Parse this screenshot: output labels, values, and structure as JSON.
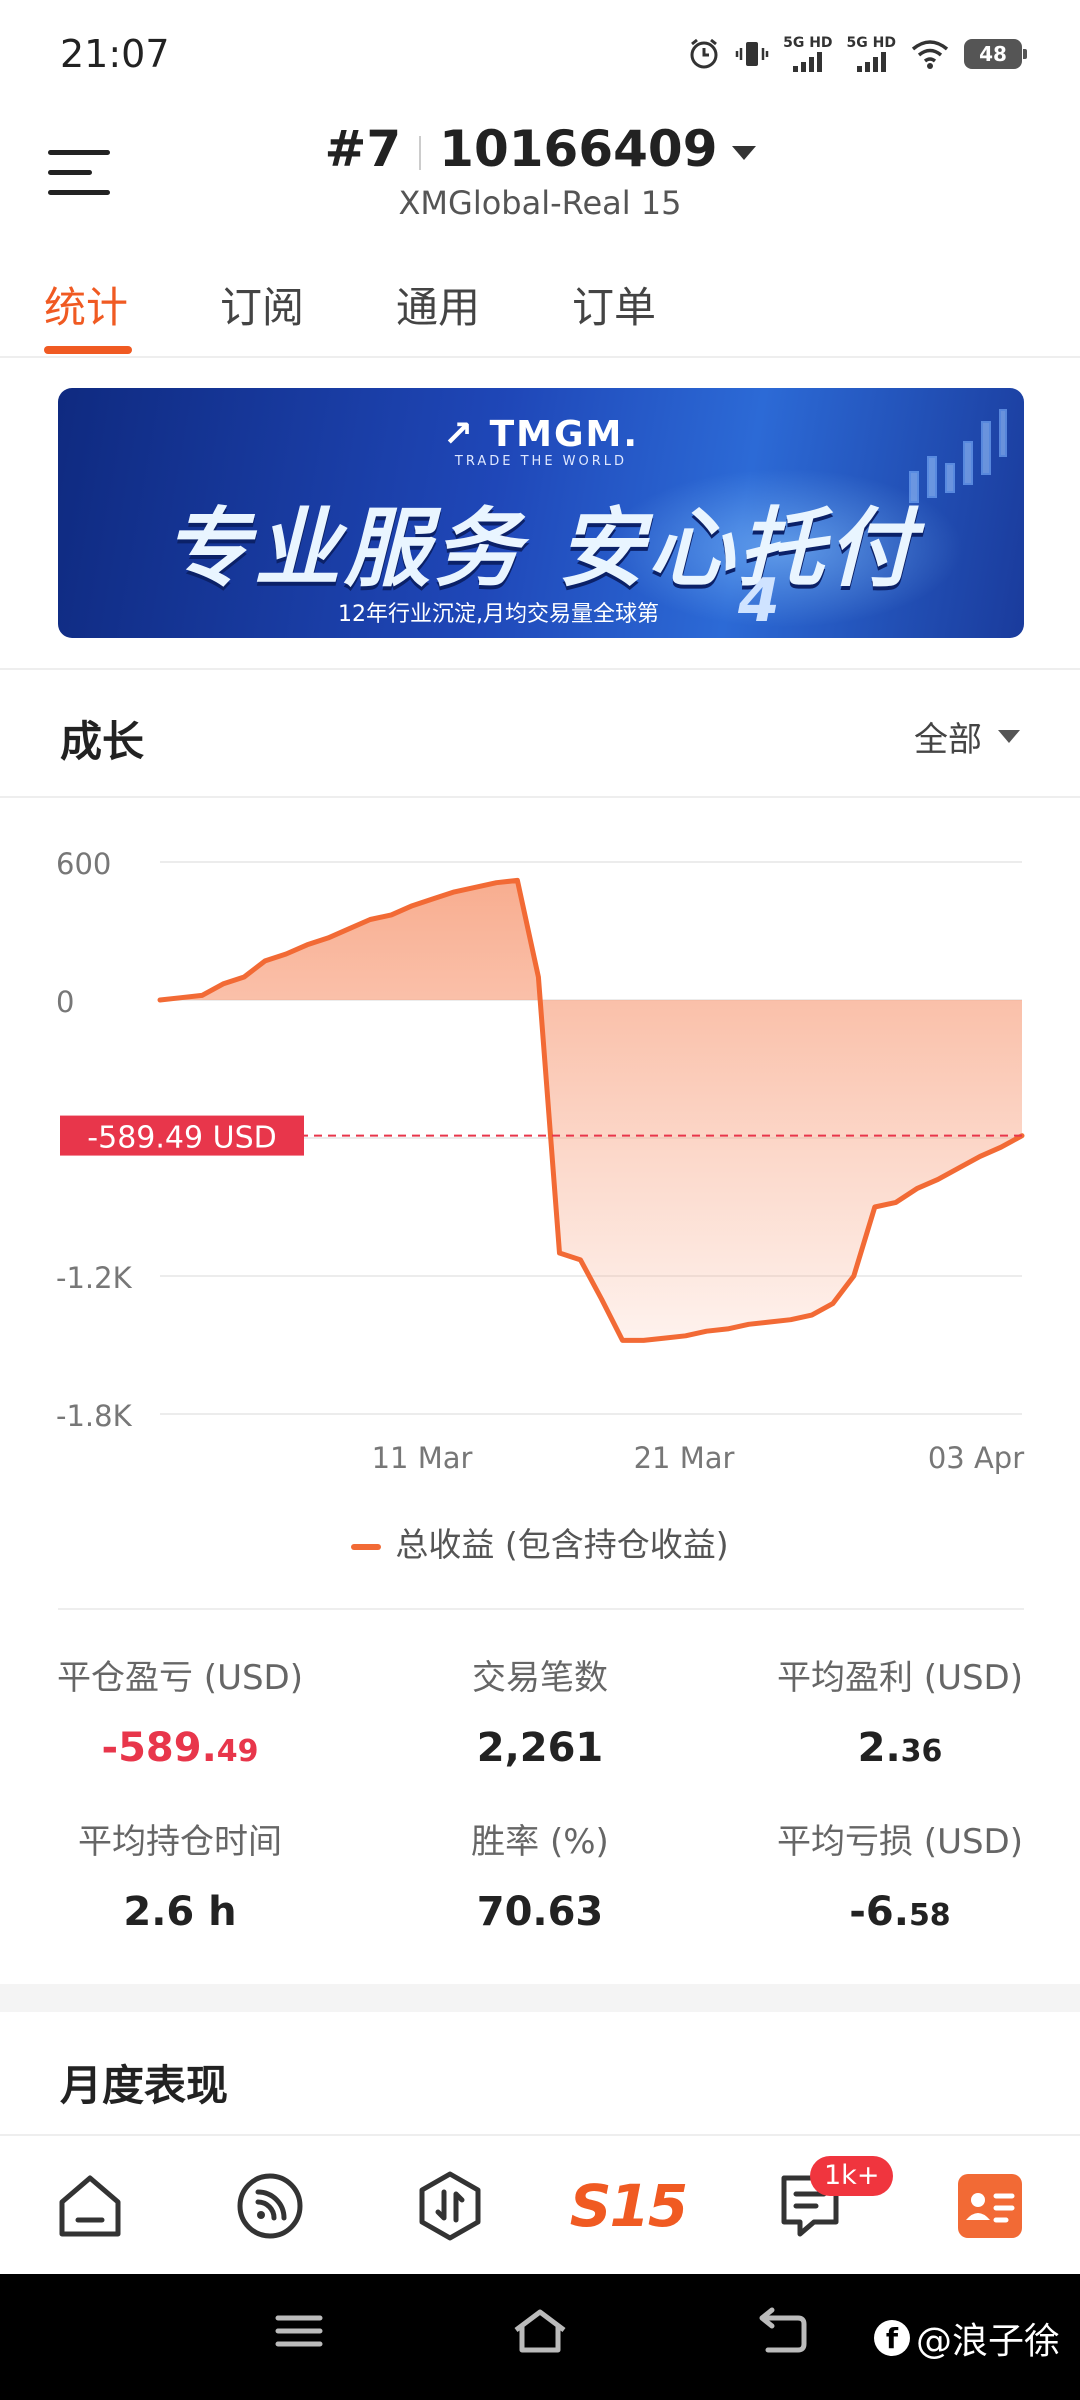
{
  "status_bar": {
    "time": "21:07",
    "network1": "5G HD",
    "network2": "5G HD",
    "battery": "48"
  },
  "header": {
    "rank": "#7",
    "account": "10166409",
    "server": "XMGlobal-Real 15"
  },
  "tabs": [
    {
      "label": "统计",
      "active": true
    },
    {
      "label": "订阅",
      "active": false
    },
    {
      "label": "通用",
      "active": false
    },
    {
      "label": "订单",
      "active": false
    }
  ],
  "banner": {
    "logo": "TMGM.",
    "tagline": "TRADE THE WORLD",
    "headline": "专业服务 安心托付",
    "footnote": "12年行业沉淀,月均交易量全球第",
    "rank_number": "4"
  },
  "growth": {
    "title": "成长",
    "filter": "全部"
  },
  "chart_data": {
    "type": "area",
    "yticks": [
      "600",
      "0",
      "-1.2K",
      "-1.8K"
    ],
    "xticks": [
      "11 Mar",
      "21 Mar",
      "03 Apr"
    ],
    "ylim": [
      -1800,
      600
    ],
    "current_value_label": "-589.49 USD",
    "current_value": -589.49,
    "series": [
      {
        "name": "总收益 (包含持仓收益)",
        "x": [
          0,
          1,
          2,
          3,
          4,
          5,
          6,
          7,
          8,
          9,
          10,
          11,
          12,
          13,
          14,
          15,
          16,
          17,
          18,
          19,
          20,
          21,
          22,
          23,
          24,
          25,
          26,
          27,
          28,
          29,
          30,
          31,
          32,
          33,
          34,
          35,
          36,
          37,
          38,
          39,
          40,
          41
        ],
        "values": [
          0,
          10,
          20,
          70,
          100,
          170,
          200,
          240,
          270,
          310,
          350,
          370,
          410,
          440,
          470,
          490,
          510,
          520,
          100,
          -1100,
          -1130,
          -1300,
          -1480,
          -1480,
          -1470,
          -1460,
          -1440,
          -1430,
          -1410,
          -1400,
          -1390,
          -1370,
          -1320,
          -1200,
          -900,
          -880,
          -820,
          -780,
          -730,
          -680,
          -640,
          -590
        ]
      }
    ],
    "colors": {
      "line": "#f26a35",
      "fill_top": "#f8a98a",
      "current_line": "#e8364b"
    }
  },
  "legend": {
    "label": "总收益 (包含持仓收益)"
  },
  "stats": [
    {
      "label": "平仓盈亏 (USD)",
      "value_main": "-589.",
      "value_small": "49",
      "negative": true
    },
    {
      "label": "交易笔数",
      "value_main": "2,261",
      "value_small": "",
      "negative": false
    },
    {
      "label": "平均盈利 (USD)",
      "value_main": "2.",
      "value_small": "36",
      "negative": false
    },
    {
      "label": "平均持仓时间",
      "value_main": "2.6 h",
      "value_small": "",
      "negative": false
    },
    {
      "label": "胜率 (%)",
      "value_main": "70.63",
      "value_small": "",
      "negative": false
    },
    {
      "label": "平均亏损 (USD)",
      "value_main": "-6.",
      "value_small": "58",
      "negative": false
    }
  ],
  "monthly": {
    "title": "月度表现"
  },
  "bottom_nav": {
    "items": [
      "home-icon",
      "signal-feed-icon",
      "trade-icon",
      "s15-logo",
      "messages-icon",
      "profile-card-icon"
    ],
    "logo_text": "S15",
    "badge": "1k+"
  },
  "watermark": {
    "fb_mark": "f",
    "text": "@浪子徐"
  }
}
